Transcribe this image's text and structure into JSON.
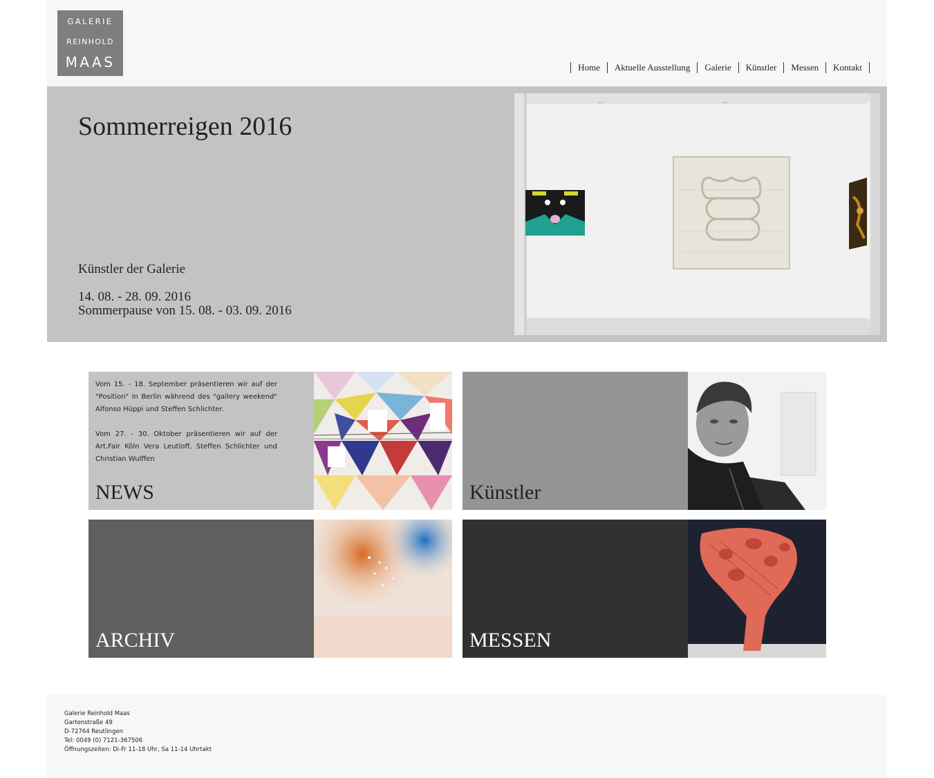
{
  "logo": {
    "line1": "GALERIE",
    "line2": "REINHOLD",
    "line3": "MAAS"
  },
  "nav": [
    "Home",
    "Aktuelle Ausstellung",
    "Galerie",
    "Künstler",
    "Messen",
    "Kontakt"
  ],
  "hero": {
    "title": "Sommerreigen 2016",
    "subtitle": "Künstler der Galerie",
    "dates": "14. 08. - 28. 09. 2016",
    "pause": "Sommerpause von 15. 08. - 03. 09. 2016"
  },
  "tiles": {
    "news": {
      "label": "NEWS",
      "para1": "Vom 15. - 18. September präsentieren wir auf der \"Position\" in Berlin während des \"gallery weekend\" Alfonso Hüppi und Steffen Schlichter.",
      "para2": "Vom 27. - 30. Oktober präsentieren wir auf der Art.Fair Köln Vera Leutloff, Steffen Schlichter und Christian Wulffen",
      "bg": "#c3c3c3"
    },
    "kuenstler": {
      "label": "Künstler",
      "bg": "#949494"
    },
    "archiv": {
      "label": "ARCHIV",
      "bg": "#5f5f5f"
    },
    "messen": {
      "label": "MESSEN",
      "bg": "#313131"
    }
  },
  "footer": {
    "lines": [
      "Galerie Reinhold Maas",
      "Gartenstraße 49",
      "D-72764 Reutlingen",
      "Tel: 0049 (0) 7121-367506",
      "Öffnungszeiten: Di-Fr 11-18 Uhr, Sa 11-14 Uhrtakt"
    ]
  }
}
